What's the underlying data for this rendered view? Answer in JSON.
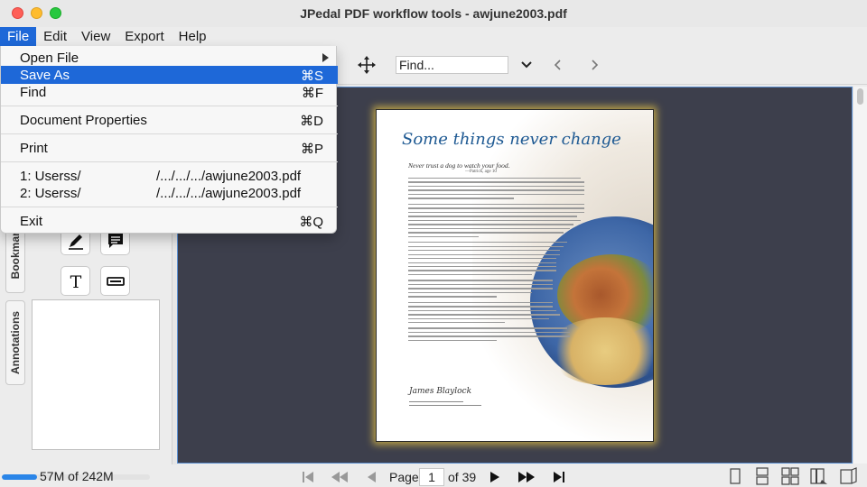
{
  "window": {
    "title": "JPedal PDF workflow tools - awjune2003.pdf"
  },
  "menubar": {
    "items": [
      "File",
      "Edit",
      "View",
      "Export",
      "Help"
    ]
  },
  "file_menu": {
    "open_file": "Open File",
    "save_as": "Save As",
    "save_as_shortcut": "⌘S",
    "find": "Find",
    "find_shortcut": "⌘F",
    "document_properties": "Document Properties",
    "document_properties_shortcut": "⌘D",
    "print": "Print",
    "print_shortcut": "⌘P",
    "recent_1_label": "1: Userss/",
    "recent_1_path": "/.../.../.../awjune2003.pdf",
    "recent_2_label": "2: Userss/",
    "recent_2_path": "/.../.../.../awjune2003.pdf",
    "exit": "Exit",
    "exit_shortcut": "⌘Q"
  },
  "toolbar": {
    "find_placeholder": "Find..."
  },
  "sidebar": {
    "tabs": [
      "Bookmarks",
      "Annotations"
    ],
    "bookmark_tab_visible": "Bookmark"
  },
  "document": {
    "title": "Some things never change",
    "subtitle": "Never trust a dog to watch your food.",
    "credit": "—Patrick, age 10",
    "signature": "James Blaylock"
  },
  "statusbar": {
    "memory": "57M of 242M",
    "memory_fraction": 0.235,
    "page_label": "Page",
    "current_page": "1",
    "total_pages": "of 39"
  },
  "colors": {
    "accent": "#1e68d8",
    "doc_background": "#3d3f4c",
    "title_blue": "#1f5a93"
  }
}
